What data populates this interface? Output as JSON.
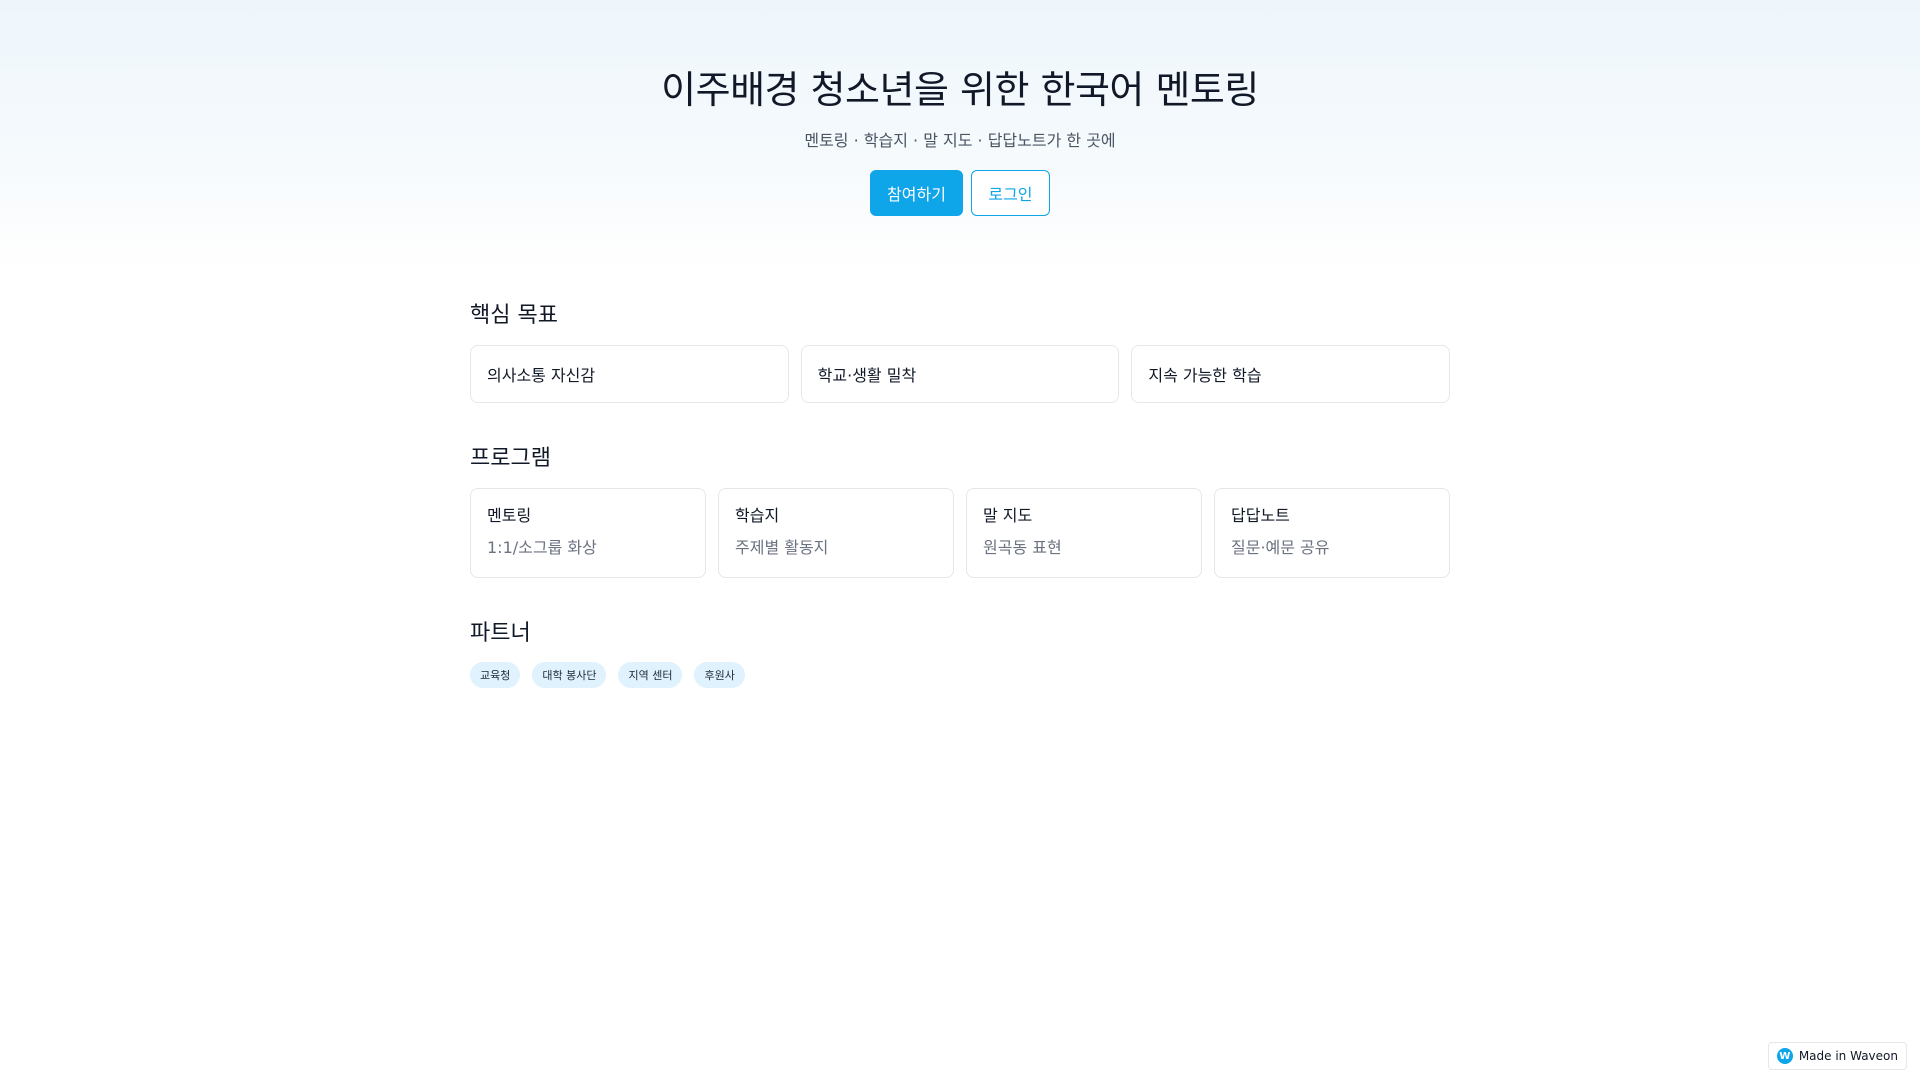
{
  "hero": {
    "title": "이주배경 청소년을 위한 한국어 멘토링",
    "subtitle": "멘토링 · 학습지 · 말 지도 · 답답노트가 한 곳에",
    "join_label": "참여하기",
    "login_label": "로그인"
  },
  "goals": {
    "title": "핵심 목표",
    "items": [
      "의사소통 자신감",
      "학교·생활 밀착",
      "지속 가능한 학습"
    ]
  },
  "programs": {
    "title": "프로그램",
    "items": [
      {
        "name": "멘토링",
        "desc": "1:1/소그룹 화상"
      },
      {
        "name": "학습지",
        "desc": "주제별 활동지"
      },
      {
        "name": "말 지도",
        "desc": "원곡동 표현"
      },
      {
        "name": "답답노트",
        "desc": "질문·예문 공유"
      }
    ]
  },
  "partners": {
    "title": "파트너",
    "items": [
      "교육청",
      "대학 봉사단",
      "지역 센터",
      "후원사"
    ]
  },
  "badge": {
    "label": "Made in Waveon",
    "logo_glyph": "W"
  },
  "colors": {
    "accent": "#0ea5e9",
    "chip_bg": "#e0f2fe"
  }
}
